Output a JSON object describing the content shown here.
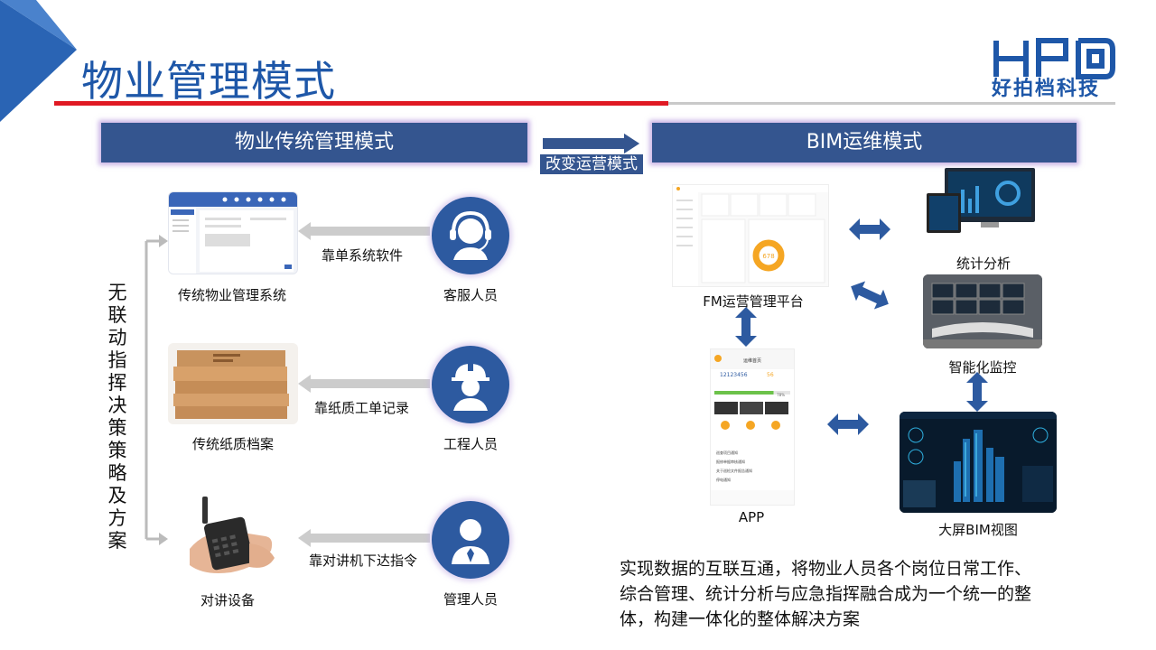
{
  "header": {
    "title": "物业管理模式",
    "logo_letters": "HPD",
    "logo_text": "好拍档科技"
  },
  "left_banner": "物业传统管理模式",
  "right_banner": "BIM运维模式",
  "transition_label": "改变运营模式",
  "vertical_text": [
    "无",
    "联",
    "动",
    "指",
    "挥",
    "决",
    "策",
    "策",
    "略",
    "及",
    "方",
    "案"
  ],
  "traditional": {
    "rows": [
      {
        "tool_caption": "传统物业管理系统",
        "method": "靠单系统软件",
        "role": "客服人员",
        "role_icon": "headset-icon",
        "tool_icon": "software-screenshot"
      },
      {
        "tool_caption": "传统纸质档案",
        "method": "靠纸质工单记录",
        "role": "工程人员",
        "role_icon": "hardhat-icon",
        "tool_icon": "paper-archive-boxes"
      },
      {
        "tool_caption": "对讲设备",
        "method": "靠对讲机下达指令",
        "role": "管理人员",
        "role_icon": "manager-icon",
        "tool_icon": "walkie-talkie"
      }
    ]
  },
  "bim": {
    "fm_platform": "FM运营管理平台",
    "app": "APP",
    "stats": "统计分析",
    "monitor": "智能化监控",
    "bigscreen": "大屏BIM视图",
    "app_screen": {
      "title": "运维首页",
      "stat1": "12123456",
      "stat2": "56",
      "progress": 0.78,
      "progress_label": "78%",
      "list_items": [
        "巡查项目通知",
        "报修单据审核通知",
        "关于巡检文件报告通知",
        "停电通知"
      ]
    },
    "donut_value": "678",
    "colors": {
      "accent": "#2d5aa0",
      "orange": "#f5a623"
    }
  },
  "description": {
    "lines": [
      "实现数据的互联互通，将物业人员各个岗位日常工作、",
      "综合管理、统计分析与应急指挥融合成为一个统一的整",
      "体，构建一体化的整体解决方案"
    ]
  }
}
